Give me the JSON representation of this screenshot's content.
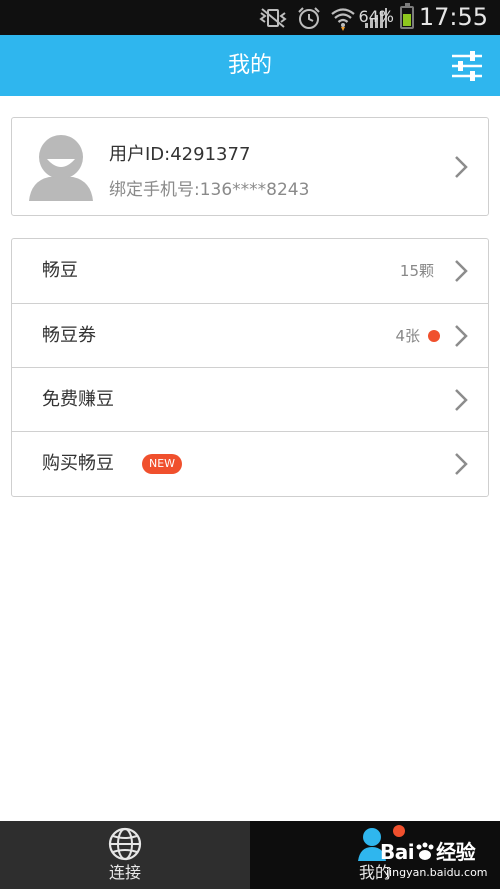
{
  "status_bar": {
    "battery_percent": "64%",
    "time": "17:55",
    "battery_level": 0.64,
    "icons": [
      "mute-vibrate-icon",
      "alarm-icon",
      "wifi-icon",
      "signal-icon",
      "battery-icon"
    ]
  },
  "header": {
    "title": "我的",
    "settings_icon": "sliders-icon"
  },
  "profile": {
    "user_id": "用户ID:4291377",
    "phone": "绑定手机号:136****8243",
    "avatar_icon": "default-avatar-icon"
  },
  "menu": {
    "items": [
      {
        "label": "畅豆",
        "value": "15颗",
        "dot": false,
        "badge": ""
      },
      {
        "label": "畅豆券",
        "value": "4张",
        "dot": true,
        "badge": ""
      },
      {
        "label": "免费赚豆",
        "value": "",
        "dot": false,
        "badge": ""
      },
      {
        "label": "购买畅豆",
        "value": "",
        "dot": false,
        "badge": "NEW"
      }
    ]
  },
  "bottom_nav": {
    "tabs": [
      {
        "label": "连接",
        "icon": "globe-icon",
        "active": false
      },
      {
        "label": "我的",
        "icon": "user-icon",
        "active": true
      }
    ]
  },
  "watermark": {
    "brand_left": "Bai",
    "brand_right": "经验",
    "url": "jingyan.baidu.com"
  },
  "colors": {
    "accent": "#2fb6ee",
    "badge_red": "#f0502d",
    "tab_inactive_bg": "#2e2e2e",
    "tab_active_bg": "#0d0d0d"
  }
}
